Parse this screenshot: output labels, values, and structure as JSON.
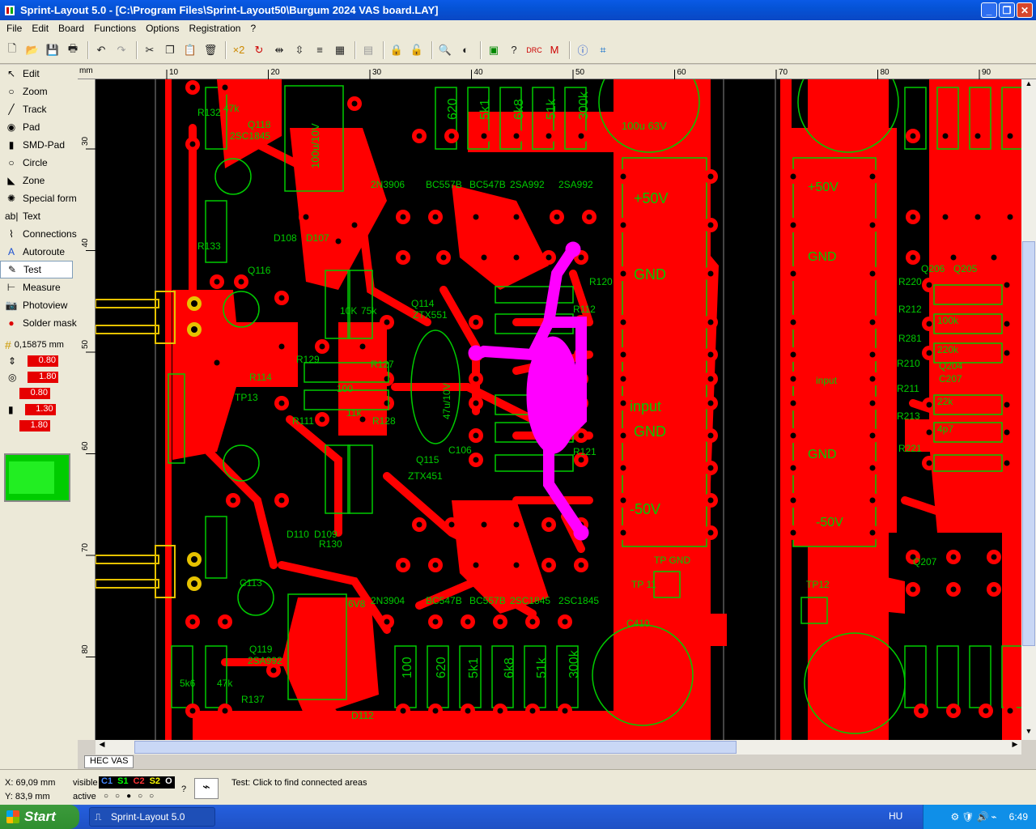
{
  "window": {
    "title": "Sprint-Layout 5.0 - [C:\\Program Files\\Sprint-Layout50\\Burgum 2024 VAS board.LAY]"
  },
  "menu": [
    "File",
    "Edit",
    "Board",
    "Functions",
    "Options",
    "Registration",
    "?"
  ],
  "tools": [
    {
      "label": "Edit",
      "icon": "arrow-cursor-icon"
    },
    {
      "label": "Zoom",
      "icon": "magnifier-icon"
    },
    {
      "label": "Track",
      "icon": "track-icon"
    },
    {
      "label": "Pad",
      "icon": "pad-icon"
    },
    {
      "label": "SMD-Pad",
      "icon": "smd-pad-icon"
    },
    {
      "label": "Circle",
      "icon": "circle-icon"
    },
    {
      "label": "Zone",
      "icon": "zone-icon"
    },
    {
      "label": "Special form",
      "icon": "special-form-icon"
    },
    {
      "label": "Text",
      "icon": "text-icon"
    },
    {
      "label": "Connections",
      "icon": "connections-icon"
    },
    {
      "label": "Autoroute",
      "icon": "autoroute-icon"
    },
    {
      "label": "Test",
      "icon": "test-icon"
    },
    {
      "label": "Measure",
      "icon": "measure-icon"
    },
    {
      "label": "Photoview",
      "icon": "camera-icon"
    },
    {
      "label": "Solder mask",
      "icon": "solder-mask-icon"
    }
  ],
  "grid": "0,15875 mm",
  "values": [
    "0.80",
    "1.80",
    "0.80",
    "1.30",
    "1.80"
  ],
  "ruler": {
    "unit": "mm",
    "x_ticks": [
      "10",
      "20",
      "30",
      "40",
      "50",
      "60",
      "70",
      "80",
      "90"
    ],
    "y_ticks": [
      "30",
      "40",
      "50",
      "60",
      "70",
      "80"
    ]
  },
  "tab": "HEC VAS",
  "status": {
    "x": "X:   69,09 mm",
    "y": "Y:    83,9 mm",
    "visible_label": "visible",
    "active_label": "active",
    "layers": [
      "C1",
      "S1",
      "C2",
      "S2",
      "O"
    ],
    "hint": "Test: Click to find connected areas"
  },
  "taskbar": {
    "start": "Start",
    "item": "Sprint-Layout 5.0",
    "lang": "HU",
    "time": "6:49"
  },
  "pcb_labels": {
    "rails_left": [
      "+50V",
      "GND",
      "input",
      "GND",
      "-50V"
    ],
    "rails_right": [
      "+50V",
      "GND",
      "input",
      "GND",
      "-50V"
    ],
    "transistors_top": [
      "2N3906",
      "BC557B",
      "BC547B",
      "2SA992",
      "2SA992"
    ],
    "transistors_bottom": [
      "2N3904",
      "BC547B",
      "BC557B",
      "2SC1845",
      "2SC1845"
    ],
    "resistors_top": [
      "620",
      "5k1",
      "6k8",
      "51k",
      "300k"
    ],
    "resistors_bottom": [
      "100",
      "620",
      "5k1",
      "6k8",
      "51k",
      "300k"
    ],
    "caps": [
      "100u/10V",
      "100u 63V",
      "47u/10V"
    ],
    "misc": [
      "R132",
      "47k",
      "Q118",
      "2SC1845",
      "R133",
      "Q116",
      "Q114",
      "ZTX551",
      "Q115",
      "ZTX451",
      "R129",
      "R127",
      "R128",
      "R111",
      "R114",
      "TP13",
      "10K",
      "75k",
      "100",
      "11k",
      "TP GND",
      "TP 11",
      "TP12",
      "C410",
      "C113",
      "Q119",
      "2SA992",
      "5k6",
      "47k",
      "R137",
      "D112",
      "6V8",
      "D108",
      "D107",
      "D110",
      "D109",
      "R130",
      "C106",
      "R120",
      "R112",
      "R121",
      "R220",
      "R212",
      "R281",
      "R210",
      "R211",
      "R213",
      "R221",
      "100k",
      "220k",
      "22k",
      "4p7",
      "C207",
      "Q204",
      "Q206",
      "Q205",
      "Q207"
    ]
  }
}
